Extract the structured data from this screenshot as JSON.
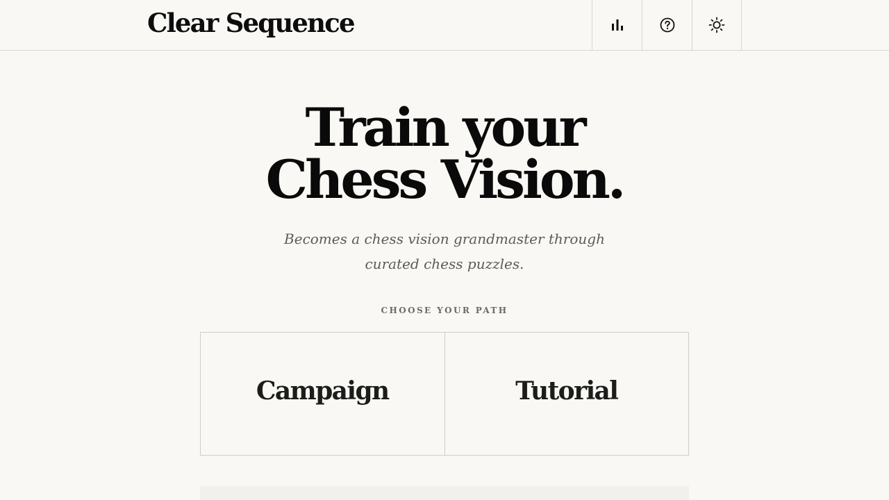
{
  "header": {
    "brand": "Clear Sequence",
    "actions": [
      {
        "icon": "bar-chart-icon",
        "label": "Stats"
      },
      {
        "icon": "help-circle-icon",
        "label": "Help"
      },
      {
        "icon": "sun-icon",
        "label": "Theme"
      }
    ]
  },
  "hero": {
    "title_line1": "Train your",
    "title_line2": "Chess Vision.",
    "subtitle": "Becomes a chess vision grandmaster through curated chess puzzles."
  },
  "paths": {
    "eyebrow": "CHOOSE YOUR PATH",
    "items": [
      {
        "title": "Campaign"
      },
      {
        "title": "Tutorial"
      }
    ]
  },
  "colors": {
    "background": "#f9f8f4",
    "text": "#0d0d0d",
    "muted": "#5b5b58",
    "border": "#d8d6d0",
    "panel": "#f1f0ec"
  }
}
